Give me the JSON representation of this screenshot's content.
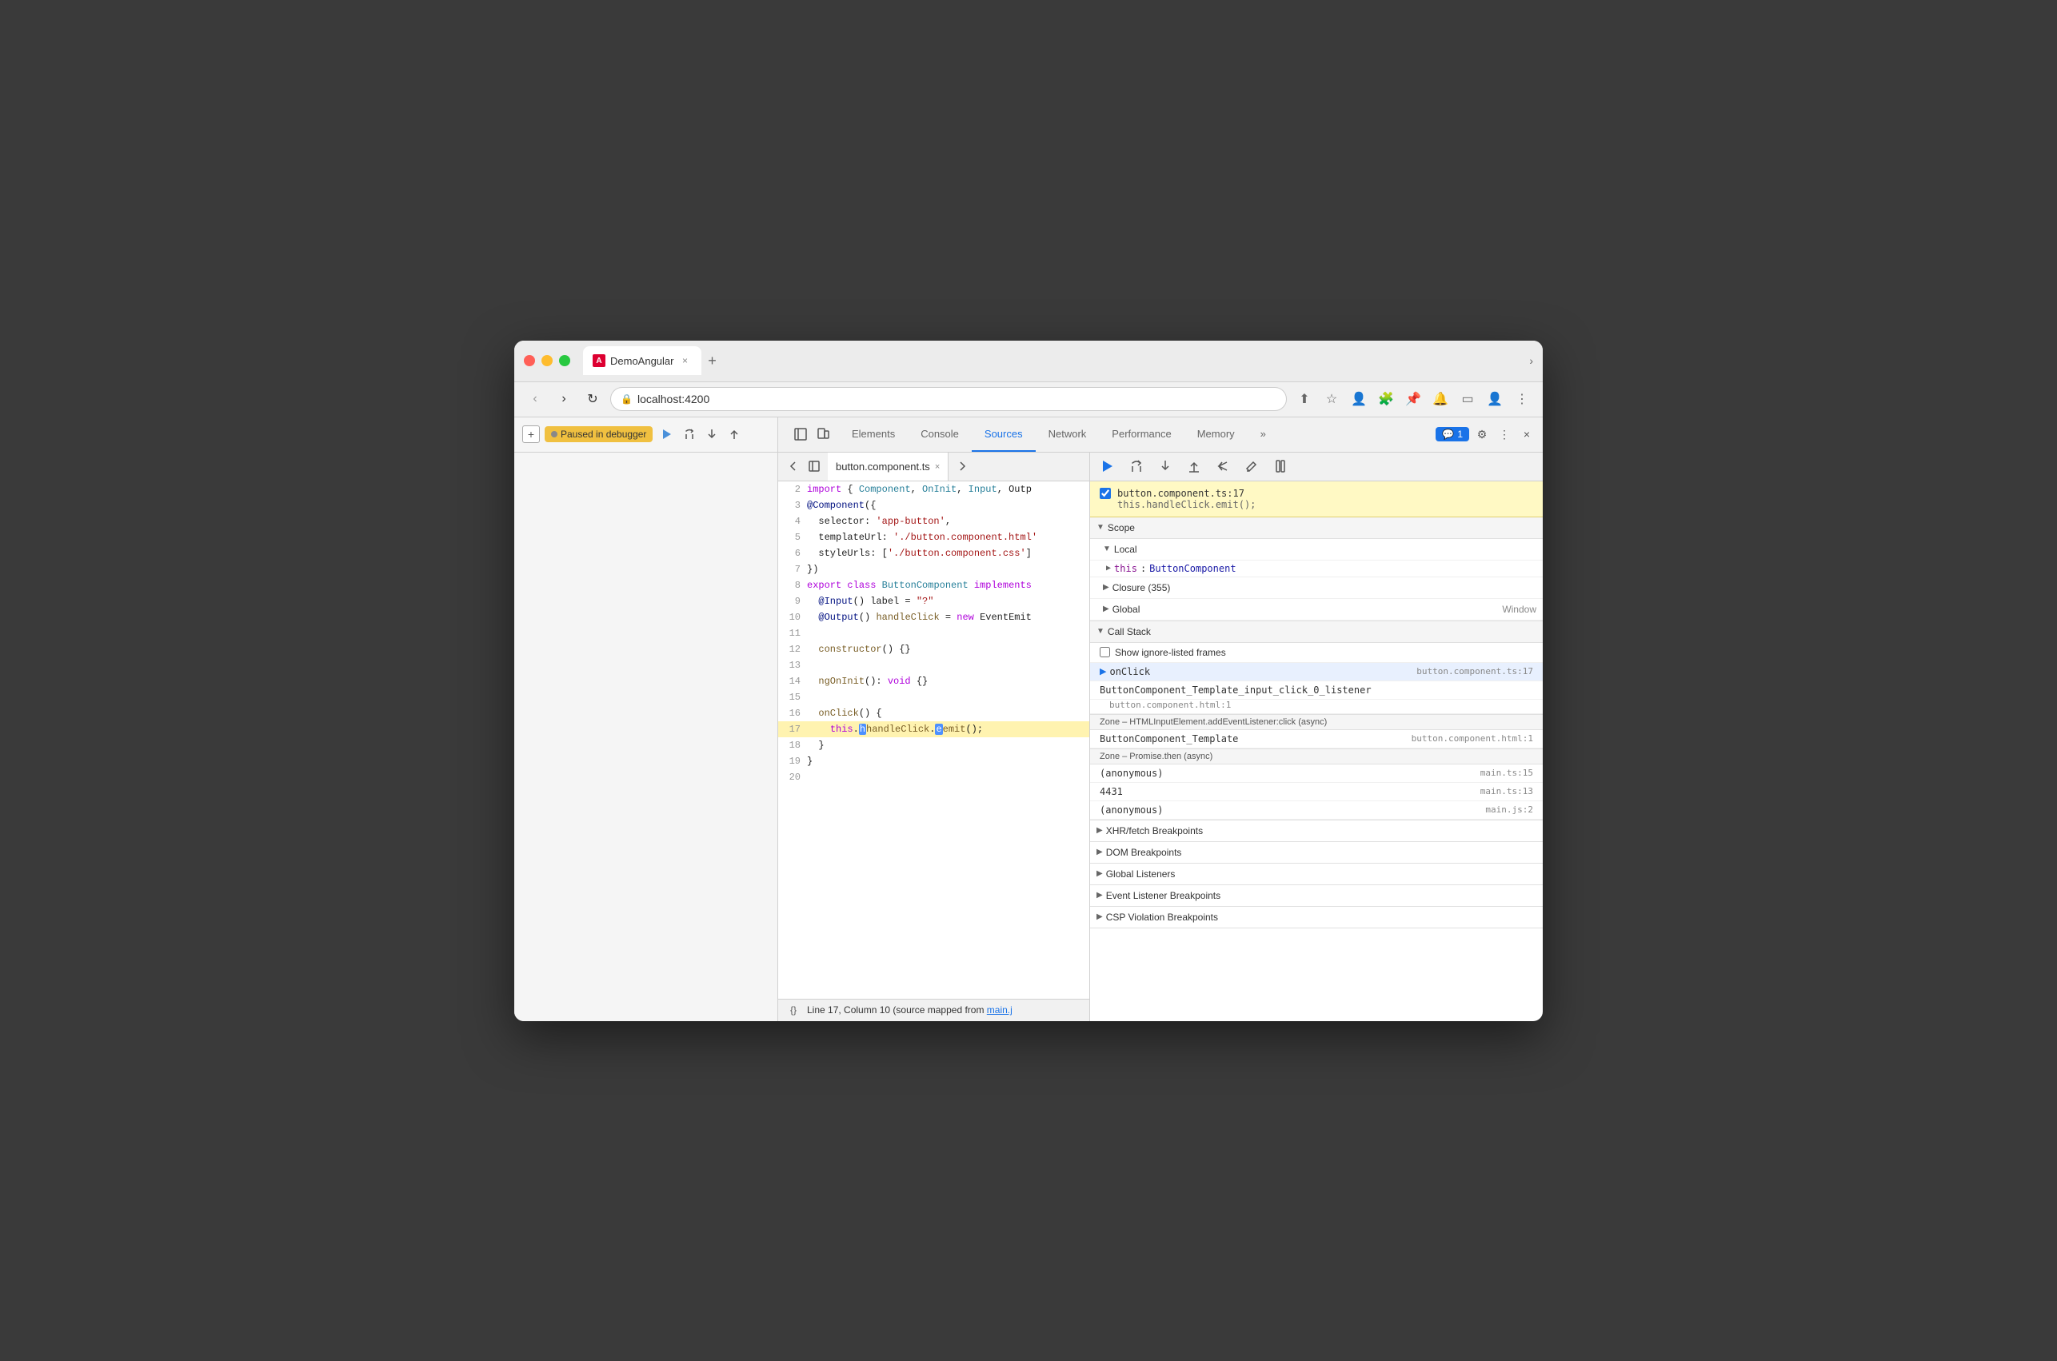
{
  "browser": {
    "tab_title": "DemoAngular",
    "tab_close": "×",
    "new_tab": "+",
    "chevron": "›",
    "address": "localhost:4200",
    "back": "‹",
    "forward": "›",
    "refresh": "↻"
  },
  "devtools": {
    "tabs": [
      "Elements",
      "Console",
      "Sources",
      "Network",
      "Performance",
      "Memory"
    ],
    "active_tab": "Sources",
    "more_tabs": "»",
    "badge_count": "1",
    "settings_icon": "⚙",
    "more_icon": "⋮",
    "close_icon": "×"
  },
  "source_panel": {
    "file_name": "button.component.ts",
    "file_close": "×",
    "status_text": "Line 17, Column 10 (source mapped from main.j",
    "status_link": "main.j",
    "source_map_icon": "{}"
  },
  "code": {
    "lines": [
      {
        "num": 2,
        "content": "import { Component, OnInit, Input, Outp"
      },
      {
        "num": 3,
        "content": "@Component({"
      },
      {
        "num": 4,
        "content": "  selector: 'app-button',"
      },
      {
        "num": 5,
        "content": "  templateUrl: './button.component.html'"
      },
      {
        "num": 6,
        "content": "  styleUrls: ['./button.component.css']"
      },
      {
        "num": 7,
        "content": "})"
      },
      {
        "num": 8,
        "content": "export class ButtonComponent implements"
      },
      {
        "num": 9,
        "content": "  @Input() label = \"?\""
      },
      {
        "num": 10,
        "content": "  @Output() handleClick = new EventEmit"
      },
      {
        "num": 11,
        "content": ""
      },
      {
        "num": 12,
        "content": "  constructor() {}"
      },
      {
        "num": 13,
        "content": ""
      },
      {
        "num": 14,
        "content": "  ngOnInit(): void {}"
      },
      {
        "num": 15,
        "content": ""
      },
      {
        "num": 16,
        "content": "  onClick() {"
      },
      {
        "num": 17,
        "content": "    this.handleClick.emit();",
        "active": true
      },
      {
        "num": 18,
        "content": "  }"
      },
      {
        "num": 19,
        "content": "}"
      },
      {
        "num": 20,
        "content": ""
      }
    ]
  },
  "paused": {
    "label": "Paused in debugger",
    "add_btn": "+",
    "resume_icon": "▶",
    "step_over_icon": "↷",
    "step_into_icon": "↓",
    "step_out_icon": "↑",
    "step_back_icon": "↺",
    "pause_icon": "⏸"
  },
  "debug_toolbar": {
    "resume": "▶",
    "step_over": "↷",
    "step_into": "↓",
    "step_out": "↑",
    "step_back": "↺",
    "edit": "✎",
    "pause_exceptions": "⏸"
  },
  "breakpoint": {
    "location": "button.component.ts:17",
    "code": "this.handleClick.emit();"
  },
  "scope": {
    "title": "Scope",
    "local_title": "Local",
    "local_items": [
      {
        "key": "▶ this",
        "val": "ButtonComponent"
      }
    ],
    "closure_title": "Closure (355)",
    "global_title": "Global",
    "global_right": "Window"
  },
  "call_stack": {
    "title": "Call Stack",
    "show_ignored": "Show ignore-listed frames",
    "items": [
      {
        "name": "onClick",
        "file": "button.component.ts:17",
        "selected": true,
        "arrow": true
      },
      {
        "name": "ButtonComponent_Template_input_click_0_listener",
        "file": ""
      },
      {
        "name": "",
        "file": "button.component.html:1",
        "indent": true
      },
      {
        "async_sep": "Zone – HTMLInputElement.addEventListener:click (async)"
      },
      {
        "name": "ButtonComponent_Template",
        "file": "button.component.html:1"
      },
      {
        "async_sep": "Zone – Promise.then (async)"
      },
      {
        "name": "(anonymous)",
        "file": "main.ts:15"
      },
      {
        "name": "4431",
        "file": "main.ts:13"
      },
      {
        "name": "(anonymous)",
        "file": "main.js:2"
      }
    ]
  },
  "panels": {
    "xhr_breakpoints": "XHR/fetch Breakpoints",
    "dom_breakpoints": "DOM Breakpoints",
    "global_listeners": "Global Listeners",
    "event_listeners": "Event Listener Breakpoints",
    "csp_violations": "CSP Violation Breakpoints"
  }
}
